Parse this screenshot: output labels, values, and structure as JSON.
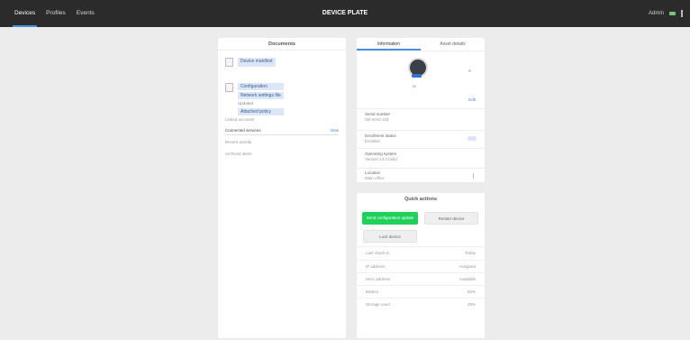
{
  "topbar": {
    "nav": [
      "Devices",
      "Profiles",
      "Events"
    ],
    "title": "DEVICE PLATE",
    "user": "Admin"
  },
  "left_panel": {
    "title": "Documents",
    "doc1": {
      "chip": "Device manifest"
    },
    "doc2": {
      "chip_a": "Configuration",
      "chip_b": "Network settings file",
      "note": "Updated",
      "chip_c": "Attached policy"
    },
    "links": [
      "Linked accounts",
      "Connected services",
      "Recent activity",
      "Archived items"
    ],
    "view_all": "View"
  },
  "profile_panel": {
    "tabs": [
      "Information",
      "Asset details"
    ],
    "avatar_caption": "ID",
    "edit": "Edit",
    "rows": [
      {
        "label": "Serial number",
        "value": "SN-0042-118"
      },
      {
        "label": "Enrollment status",
        "value": "Enrolled"
      },
      {
        "label": "Operating system",
        "value": "Version 14.2 build"
      },
      {
        "label": "Location",
        "value": "Main office"
      }
    ]
  },
  "actions_panel": {
    "title": "Quick actions",
    "primary": "Send configuration update",
    "secondary": "Restart device",
    "tertiary": "Lock device",
    "rows": [
      {
        "k": "Last check-in",
        "v": "Today"
      },
      {
        "k": "IP address",
        "v": "Assigned"
      },
      {
        "k": "MAC address",
        "v": "Available"
      },
      {
        "k": "Battery",
        "v": "92%"
      },
      {
        "k": "Storage used",
        "v": "48%"
      }
    ]
  }
}
